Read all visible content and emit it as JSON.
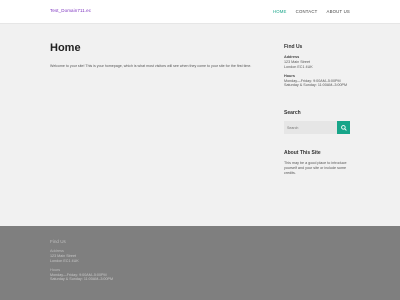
{
  "site": {
    "logo_text": "Test_Domain711.ec"
  },
  "nav": {
    "items": [
      "HOME",
      "CONTACT",
      "ABOUT US"
    ]
  },
  "main": {
    "title": "Home",
    "intro": "Welcome to your site! This is your homepage, which is what most visitors will see when they come to your site for the first time."
  },
  "sidebar": {
    "find_us": {
      "title": "Find Us",
      "address_label": "Address",
      "address_line1": "123 Main Street",
      "address_line2": "London EC1 4UK",
      "hours_label": "Hours",
      "hours_line1": "Monday—Friday: 9:00AM–5:00PM",
      "hours_line2": "Saturday & Sunday: 11:00AM–3:00PM"
    },
    "search": {
      "title": "Search",
      "placeholder": "Search"
    },
    "about": {
      "title": "About This Site",
      "text": "This may be a good place to introduce yourself and your site or include some credits."
    }
  },
  "footer": {
    "title": "Find Us",
    "address_label": "Address",
    "address_line1": "123 Main Street",
    "address_line2": "London EC1 4UK",
    "hours_label": "Hours",
    "hours_line1": "Monday—Friday: 9:00AM–5:00PM",
    "hours_line2": "Saturday & Sunday: 11:00AM–3:00PM"
  },
  "colors": {
    "accent": "#17a589",
    "logo": "#7b2fbf",
    "footer_bg": "#7f7f7f",
    "page_bg": "#f1f1f1"
  },
  "icons": {
    "search_button": "search-icon"
  }
}
